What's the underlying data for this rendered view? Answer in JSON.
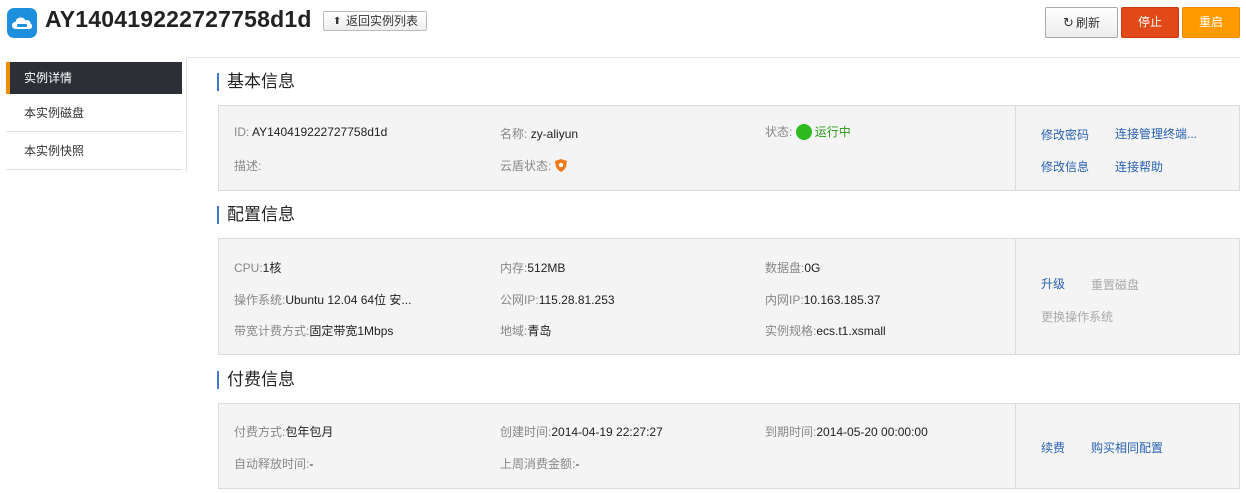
{
  "header": {
    "instance_id": "AY140419222727758d1d",
    "back_label": "返回实例列表",
    "refresh_label": "刷新",
    "stop_label": "停止",
    "restart_label": "重启"
  },
  "sidebar": {
    "items": [
      {
        "label": "实例详情",
        "active": true
      },
      {
        "label": "本实例磁盘",
        "active": false
      },
      {
        "label": "本实例快照",
        "active": false
      }
    ]
  },
  "basic": {
    "title": "基本信息",
    "id_label": "ID:",
    "id_value": "AY140419222727758d1d",
    "name_label": "名称:",
    "name_value": "zy-aliyun",
    "status_label": "状态:",
    "status_value": "运行中",
    "desc_label": "描述:",
    "shield_label": "云盾状态:",
    "actions": {
      "change_password": "修改密码",
      "connect_terminal": "连接管理终端...",
      "modify_info": "修改信息",
      "connect_help": "连接帮助"
    }
  },
  "config": {
    "title": "配置信息",
    "cpu_label": "CPU:",
    "cpu_value": "1核",
    "mem_label": "内存:",
    "mem_value": "512MB",
    "disk_label": "数据盘:",
    "disk_value": "0G",
    "os_label": "操作系统:",
    "os_value": "Ubuntu 12.04 64位 安...",
    "pubip_label": "公网IP:",
    "pubip_value": "115.28.81.253",
    "privip_label": "内网IP:",
    "privip_value": "10.163.185.37",
    "bw_label": "带宽计费方式:",
    "bw_value": "固定带宽1Mbps",
    "region_label": "地域:",
    "region_value": "青岛",
    "spec_label": "实例规格:",
    "spec_value": "ecs.t1.xsmall",
    "actions": {
      "upgrade": "升级",
      "reset_disk": "重置磁盘",
      "change_os": "更换操作系统"
    }
  },
  "billing": {
    "title": "付费信息",
    "pay_label": "付费方式:",
    "pay_value": "包年包月",
    "created_label": "创建时间:",
    "created_value": "2014-04-19 22:27:27",
    "expire_label": "到期时间:",
    "expire_value": "2014-05-20 00:00:00",
    "autorelease_label": "自动释放时间:",
    "autorelease_value": "-",
    "lastweek_label": "上周消费金额:",
    "lastweek_value": "-",
    "actions": {
      "renew": "续费",
      "buy_same": "购买相同配置"
    }
  },
  "colors": {
    "accent": "#3e7ad3",
    "stop": "#e14a18",
    "restart": "#ff9a00",
    "running": "#2dbb1f",
    "link": "#2a62b3"
  }
}
